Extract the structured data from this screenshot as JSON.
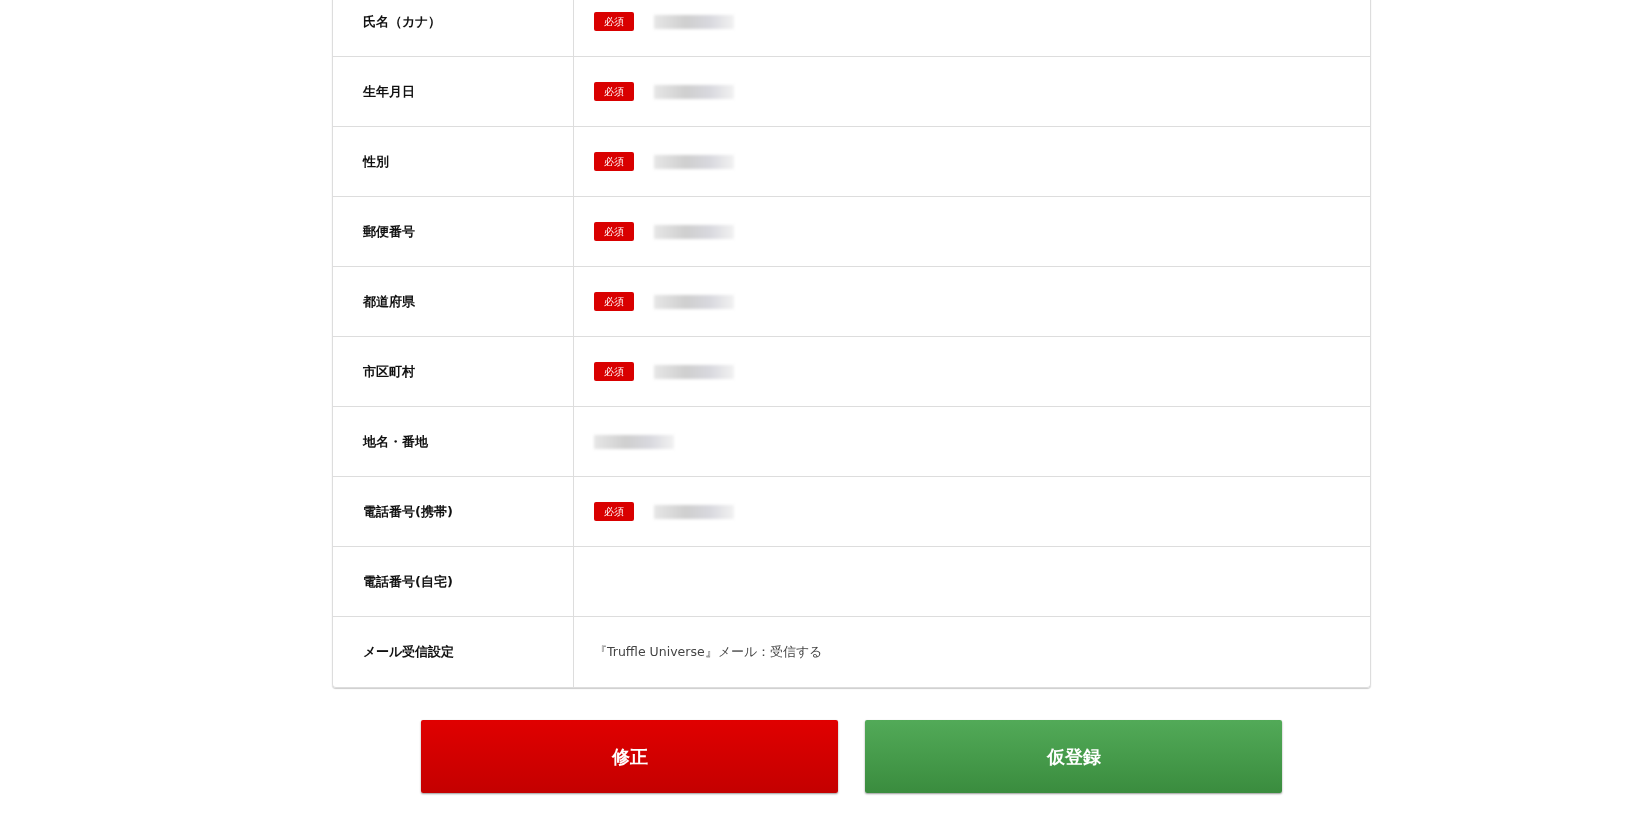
{
  "rows": [
    {
      "label": "氏名（カナ）",
      "required": true,
      "required_badge": "必須",
      "kind": "redacted"
    },
    {
      "label": "生年月日",
      "required": true,
      "required_badge": "必須",
      "kind": "redacted"
    },
    {
      "label": "性別",
      "required": true,
      "required_badge": "必須",
      "kind": "redacted"
    },
    {
      "label": "郵便番号",
      "required": true,
      "required_badge": "必須",
      "kind": "redacted"
    },
    {
      "label": "都道府県",
      "required": true,
      "required_badge": "必須",
      "kind": "redacted"
    },
    {
      "label": "市区町村",
      "required": true,
      "required_badge": "必須",
      "kind": "redacted"
    },
    {
      "label": "地名・番地",
      "required": false,
      "kind": "redacted"
    },
    {
      "label": "電話番号(携帯)",
      "required": true,
      "required_badge": "必須",
      "kind": "redacted"
    },
    {
      "label": "電話番号(自宅)",
      "required": false,
      "kind": "empty"
    },
    {
      "label": "メール受信設定",
      "required": false,
      "kind": "text",
      "value": "『Truffle Universe』メール：受信する"
    }
  ],
  "buttons": [
    {
      "label": "修正",
      "kind": "edit"
    },
    {
      "label": "仮登録",
      "kind": "submit"
    }
  ]
}
